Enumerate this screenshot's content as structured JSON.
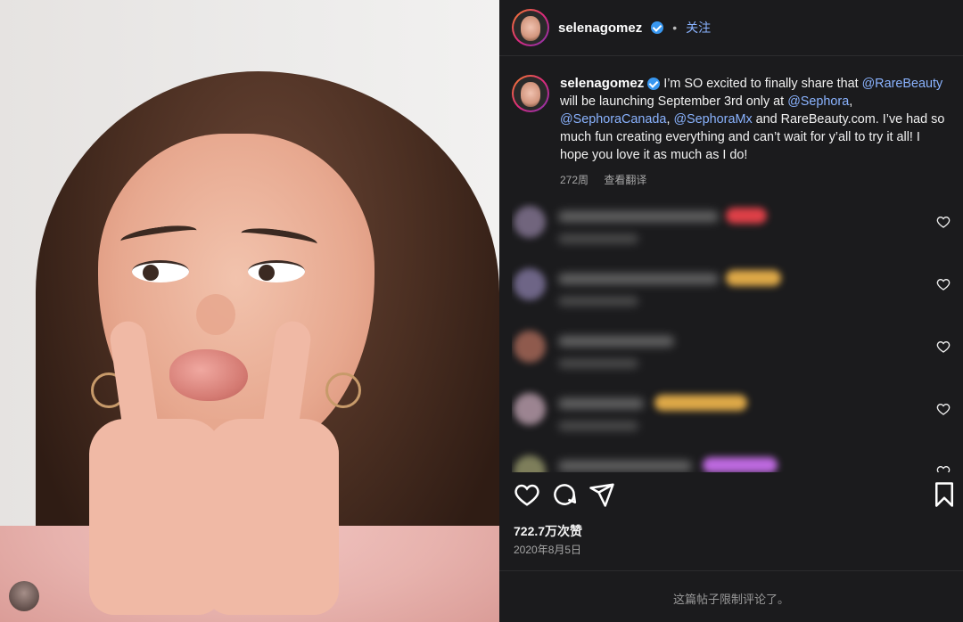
{
  "post": {
    "username": "selenagomez",
    "follow_label": "关注",
    "caption_parts": {
      "p1": "I’m SO excited to finally share that ",
      "m1": "@RareBeauty",
      "p2": " will be launching September 3rd only at ",
      "m2": "@Sephora",
      "p3": ",",
      "m3": "@SephoraCanada",
      "p4": ", ",
      "m4": "@SephoraMx",
      "p5": " and RareBeauty.com. I’ve had so much fun creating everything and can’t wait for y’all to try it all! I hope you love it as much as I do!"
    },
    "caption_time": "272周",
    "translate_label": "查看翻译",
    "likes": "722.7万次赞",
    "date": "2020年8月5日",
    "comments_limited": "这篇帖子限制评论了。"
  },
  "comments": [
    {
      "emoji_color": "#e8424a"
    },
    {
      "emoji_color": "#e8b04a"
    },
    {
      "emoji_color": ""
    },
    {
      "emoji_color": "#e8b04a"
    },
    {
      "emoji_color": "#c56de8"
    }
  ],
  "icons": [
    "verified-badge-icon",
    "heart-icon",
    "comment-icon",
    "share-icon",
    "bookmark-icon"
  ],
  "colors": {
    "mention": "#8ab3ff",
    "panel_bg": "#1b1b1d",
    "verified": "#3897f0"
  }
}
